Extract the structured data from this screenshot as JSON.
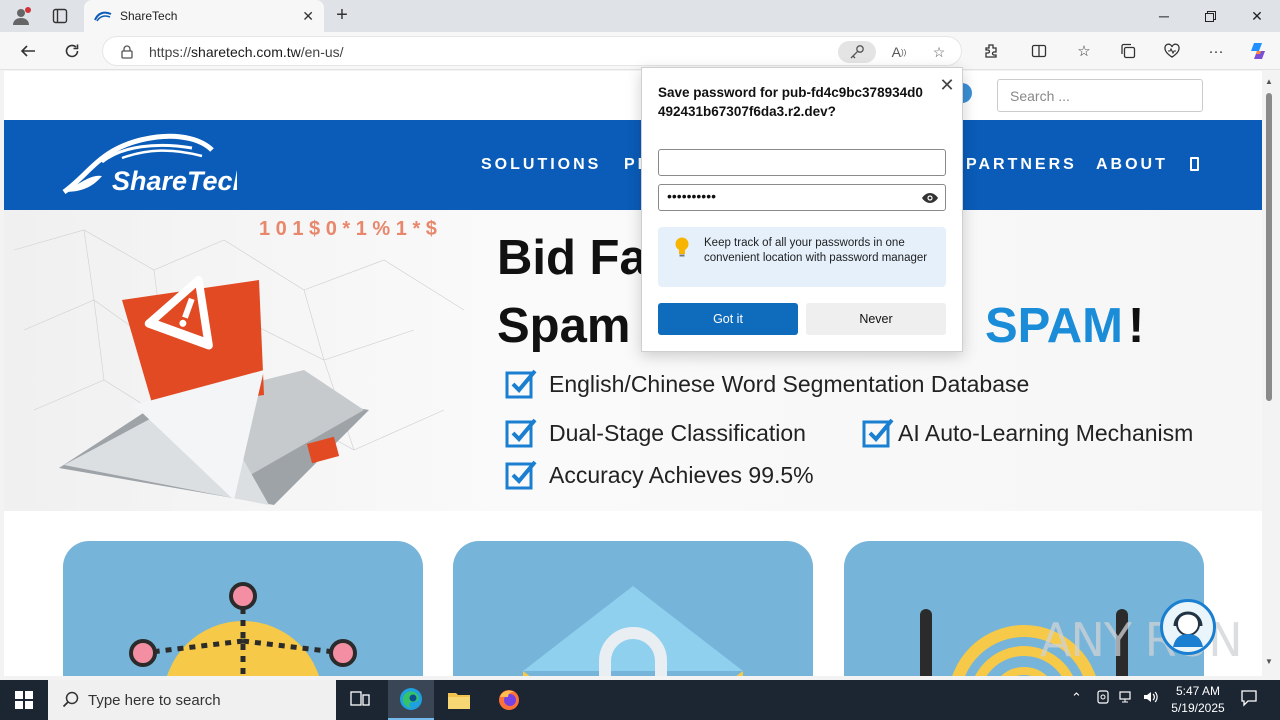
{
  "browser": {
    "tab_title": "ShareTech",
    "url_prefix": "https://",
    "url_domain": "sharetech.com.tw",
    "url_path": "/en-us/"
  },
  "site": {
    "search_placeholder": "Search ...",
    "logo_text": "ShareTech",
    "nav": [
      "SOLUTIONS",
      "PR",
      "PARTNERS",
      "ABOUT"
    ],
    "hero": {
      "line1": "Bid Fa",
      "line2a": "Spam",
      "line2b": "SPAM",
      "line2c": "!",
      "features": [
        "English/Chinese Word Segmentation Database",
        "Dual-Stage Classification",
        "AI Auto-Learning Mechanism",
        "Accuracy Achieves 99.5%"
      ],
      "deco_chars": "1 0 1 $ 0 * 1 % 1 * $"
    }
  },
  "password_popup": {
    "title": "Save password for pub-fd4c9bc378934d0492431b67307f6da3.r2.dev?",
    "username_value": "",
    "password_masked": "••••••••••",
    "tip": "Keep track of all your passwords in one convenient location with password manager",
    "got_it_label": "Got it",
    "never_label": "Never"
  },
  "taskbar": {
    "search_placeholder": "Type here to search",
    "time": "5:47 AM",
    "date": "5/19/2025"
  },
  "watermark": "ANY RUN",
  "colors": {
    "header_blue": "#0a5cb8",
    "spam_blue": "#1a8cd8",
    "card_blue": "#76b4d9",
    "button_blue": "#0f6cbd"
  }
}
